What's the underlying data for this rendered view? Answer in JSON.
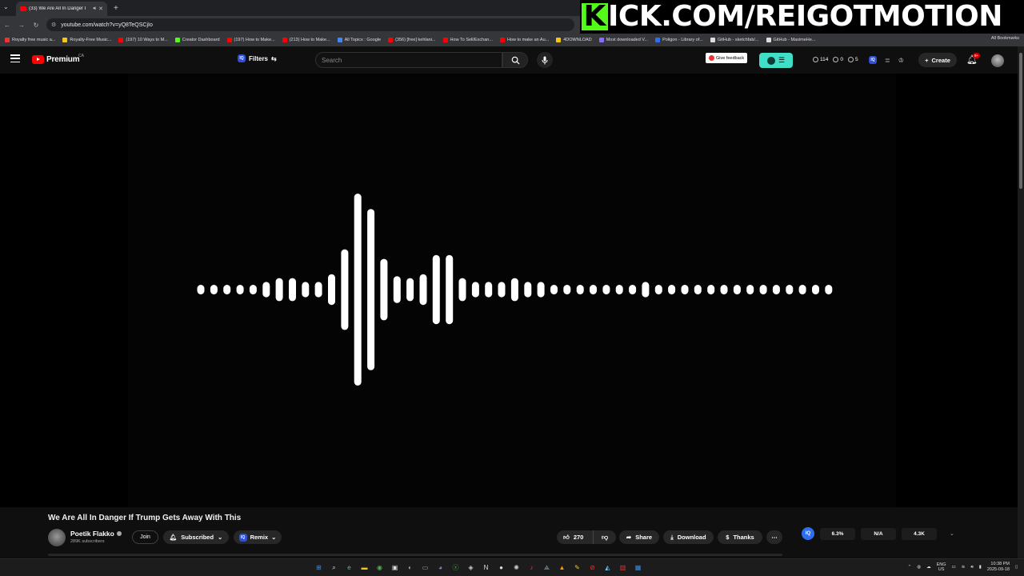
{
  "browser": {
    "tab_title": "(33) We Are All In Danger I",
    "url": "youtube.com/watch?v=yQ8TeQSCjIo",
    "bookmarks": [
      {
        "label": "Royalty free music a...",
        "color": "#e33"
      },
      {
        "label": "Royalty-Free Music...",
        "color": "#f5c518"
      },
      {
        "label": "(197) 10 Ways to M...",
        "color": "#ff0000"
      },
      {
        "label": "Creator Dashboard",
        "color": "#53fc18"
      },
      {
        "label": "(197) How to Make...",
        "color": "#ff0000"
      },
      {
        "label": "(213) How to Make...",
        "color": "#ff0000"
      },
      {
        "label": "All Topics : Google",
        "color": "#4285f4"
      },
      {
        "label": "(356) [free] kehlani...",
        "color": "#ff0000"
      },
      {
        "label": "How To Sell/Exchan...",
        "color": "#ff0000"
      },
      {
        "label": "How to make an Au...",
        "color": "#ff0000"
      },
      {
        "label": "4DOWNLOAD",
        "color": "#f5c518"
      },
      {
        "label": "Most downloaded V...",
        "color": "#8a6cff"
      },
      {
        "label": "Poligon - Library of...",
        "color": "#2e6ef0"
      },
      {
        "label": "GitHub - sketchfab/...",
        "color": "#dddddd"
      },
      {
        "label": "GitHub - MaximeHe...",
        "color": "#dddddd"
      }
    ],
    "all_bookmarks": "All Bookmarks"
  },
  "overlay": {
    "k": "K",
    "text": "ICK.COM/REIGOTMOTION"
  },
  "youtube": {
    "logo": "Premium",
    "country": "CA",
    "filters": "Filters",
    "search_placeholder": "Search",
    "feedback": "Give feedback",
    "stats": {
      "a": "114",
      "b": "0",
      "c": "5"
    },
    "create": "Create",
    "notif_badge": "9+"
  },
  "video": {
    "title": "We Are All In Danger If Trump Gets Away With This",
    "channel": "Poetik Flakko",
    "subscribers": "289K subscribers",
    "join": "Join",
    "subscribed": "Subscribed",
    "remix": "Remix",
    "likes": "270",
    "share": "Share",
    "download": "Download",
    "thanks": "Thanks"
  },
  "iq": {
    "logo": "IQ",
    "stat1": "6.3%",
    "stat2": "N/A",
    "stat3": "4.3K"
  },
  "waveform": {
    "bars": [
      0.05,
      0.05,
      0.05,
      0.05,
      0.05,
      0.08,
      0.12,
      0.12,
      0.08,
      0.08,
      0.16,
      0.42,
      1.0,
      0.84,
      0.32,
      0.14,
      0.12,
      0.16,
      0.36,
      0.36,
      0.12,
      0.08,
      0.08,
      0.08,
      0.12,
      0.08,
      0.08,
      0.05,
      0.05,
      0.05,
      0.05,
      0.05,
      0.05,
      0.05,
      0.08,
      0.05,
      0.05,
      0.05,
      0.05,
      0.05,
      0.05,
      0.05,
      0.05,
      0.05,
      0.05,
      0.05,
      0.05,
      0.05,
      0.05
    ],
    "color": "#ffffff"
  },
  "taskbar": {
    "icons": [
      {
        "name": "windows-start-icon",
        "glyph": "⊞",
        "color": "#3a8ee6"
      },
      {
        "name": "search-icon",
        "glyph": "⌕",
        "color": "#dddddd"
      },
      {
        "name": "edge-icon",
        "glyph": "e",
        "color": "#2ec4c4"
      },
      {
        "name": "file-explorer-icon",
        "glyph": "▬",
        "color": "#f5c518"
      },
      {
        "name": "chrome-icon",
        "glyph": "◉",
        "color": "#4caf50"
      },
      {
        "name": "store-icon",
        "glyph": "▣",
        "color": "#dddddd"
      },
      {
        "name": "steam-icon",
        "glyph": "◐",
        "color": "#9ab"
      },
      {
        "name": "app-icon",
        "glyph": "▭",
        "color": "#aaa"
      },
      {
        "name": "discord-icon",
        "glyph": "◕",
        "color": "#7289da"
      },
      {
        "name": "xbox-icon",
        "glyph": "ⓧ",
        "color": "#4caf50"
      },
      {
        "name": "app2-icon",
        "glyph": "◈",
        "color": "#ccc"
      },
      {
        "name": "notion-icon",
        "glyph": "N",
        "color": "#ddd"
      },
      {
        "name": "github-icon",
        "glyph": "●",
        "color": "#ddd"
      },
      {
        "name": "davinci-icon",
        "glyph": "✺",
        "color": "#ccc"
      },
      {
        "name": "tiktok-icon",
        "glyph": "♪",
        "color": "#ff2d55"
      },
      {
        "name": "app3-icon",
        "glyph": "⟁",
        "color": "#8ab"
      },
      {
        "name": "fl-studio-icon",
        "glyph": "▲",
        "color": "#ff9800"
      },
      {
        "name": "pencil-icon",
        "glyph": "✎",
        "color": "#f5c518"
      },
      {
        "name": "app4-icon",
        "glyph": "⊘",
        "color": "#e33"
      },
      {
        "name": "app5-icon",
        "glyph": "◭",
        "color": "#6cf"
      },
      {
        "name": "app6-icon",
        "glyph": "▥",
        "color": "#e33"
      },
      {
        "name": "app7-icon",
        "glyph": "▦",
        "color": "#3a8ee6"
      }
    ],
    "lang_top": "ENG",
    "lang_bottom": "US",
    "time": "10:38 PM",
    "date": "2025-09-18"
  }
}
